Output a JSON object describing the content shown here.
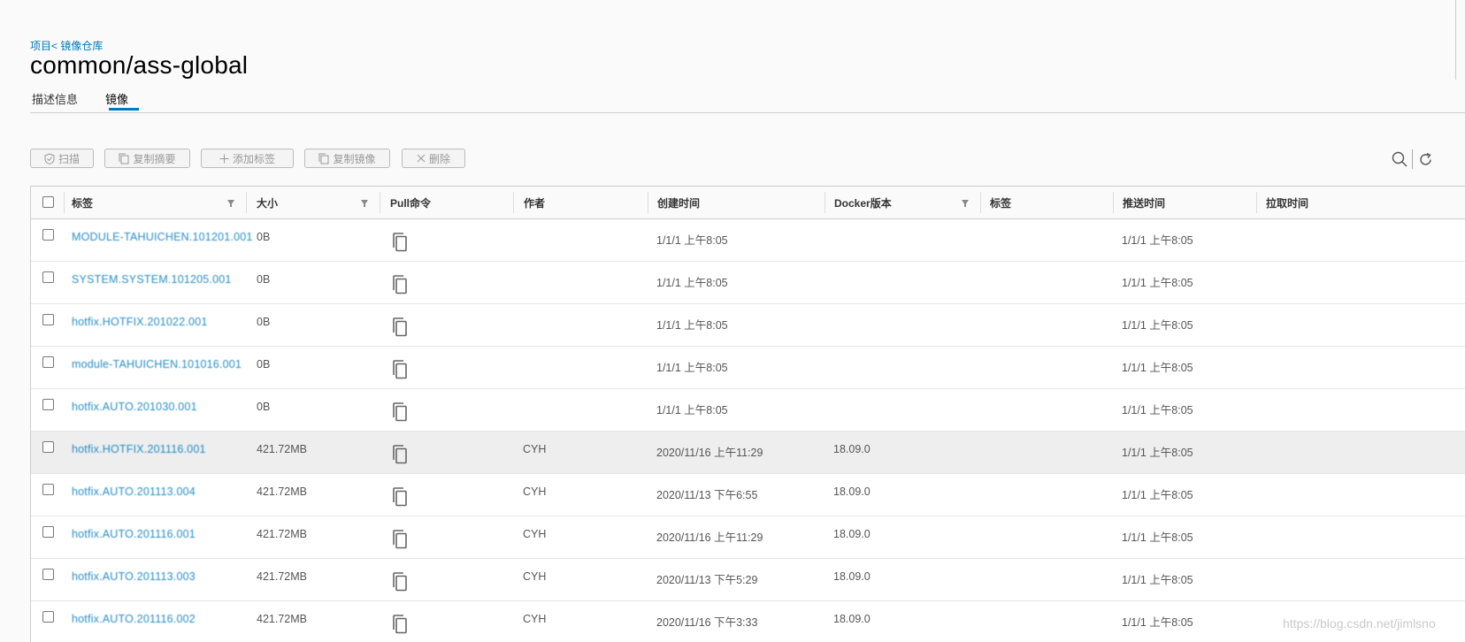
{
  "breadcrumb": {
    "project": "项目",
    "separator": "<",
    "repo": "镜像仓库"
  },
  "page": {
    "title": "common/ass-global"
  },
  "tabs": [
    {
      "label": "描述信息",
      "active": false
    },
    {
      "label": "镜像",
      "active": true
    }
  ],
  "toolbar": {
    "scan": {
      "label": "扫描",
      "icon": "shield-icon"
    },
    "copy_digest": {
      "label": "复制摘要",
      "icon": "copy-icon"
    },
    "add_tag": {
      "label": "添加标签",
      "icon": "plus-icon"
    },
    "copy_image": {
      "label": "复制镜像",
      "icon": "copy-icon"
    },
    "delete": {
      "label": "删除",
      "icon": "close-icon"
    },
    "search_icon": "search-icon",
    "refresh_icon": "refresh-icon"
  },
  "table": {
    "columns": {
      "tag": "标签",
      "size": "大小",
      "pull": "Pull命令",
      "author": "作者",
      "created": "创建时间",
      "docker": "Docker版本",
      "labels": "标签",
      "pushed": "推送时间",
      "pulled": "拉取时间"
    },
    "rows": [
      {
        "tag": "MODULE-TAHUICHEN.101201.001",
        "size": "0B",
        "author": "",
        "created": "1/1/1 上午8:05",
        "docker": "",
        "pushed": "1/1/1 上午8:05",
        "pulled": ""
      },
      {
        "tag": "SYSTEM.SYSTEM.101205.001",
        "size": "0B",
        "author": "",
        "created": "1/1/1 上午8:05",
        "docker": "",
        "pushed": "1/1/1 上午8:05",
        "pulled": ""
      },
      {
        "tag": "hotfix.HOTFIX.201022.001",
        "size": "0B",
        "author": "",
        "created": "1/1/1 上午8:05",
        "docker": "",
        "pushed": "1/1/1 上午8:05",
        "pulled": ""
      },
      {
        "tag": "module-TAHUICHEN.101016.001",
        "size": "0B",
        "author": "",
        "created": "1/1/1 上午8:05",
        "docker": "",
        "pushed": "1/1/1 上午8:05",
        "pulled": ""
      },
      {
        "tag": "hotfix.AUTO.201030.001",
        "size": "0B",
        "author": "",
        "created": "1/1/1 上午8:05",
        "docker": "",
        "pushed": "1/1/1 上午8:05",
        "pulled": ""
      },
      {
        "tag": "hotfix.HOTFIX.201116.001",
        "size": "421.72MB",
        "author": "CYH",
        "created": "2020/11/16 上午11:29",
        "docker": "18.09.0",
        "pushed": "1/1/1 上午8:05",
        "pulled": "",
        "highlight": true
      },
      {
        "tag": "hotfix.AUTO.201113.004",
        "size": "421.72MB",
        "author": "CYH",
        "created": "2020/11/13 下午6:55",
        "docker": "18.09.0",
        "pushed": "1/1/1 上午8:05",
        "pulled": ""
      },
      {
        "tag": "hotfix.AUTO.201116.001",
        "size": "421.72MB",
        "author": "CYH",
        "created": "2020/11/16 上午11:29",
        "docker": "18.09.0",
        "pushed": "1/1/1 上午8:05",
        "pulled": ""
      },
      {
        "tag": "hotfix.AUTO.201113.003",
        "size": "421.72MB",
        "author": "CYH",
        "created": "2020/11/13 下午5:29",
        "docker": "18.09.0",
        "pushed": "1/1/1 上午8:05",
        "pulled": ""
      },
      {
        "tag": "hotfix.AUTO.201116.002",
        "size": "421.72MB",
        "author": "CYH",
        "created": "2020/11/16 下午3:33",
        "docker": "18.09.0",
        "pushed": "1/1/1 上午8:05",
        "pulled": ""
      }
    ]
  },
  "watermark": "https://blog.csdn.net/jimlsno",
  "colors": {
    "accent": "#0079b8",
    "highlight_row": "#eeeeee"
  }
}
